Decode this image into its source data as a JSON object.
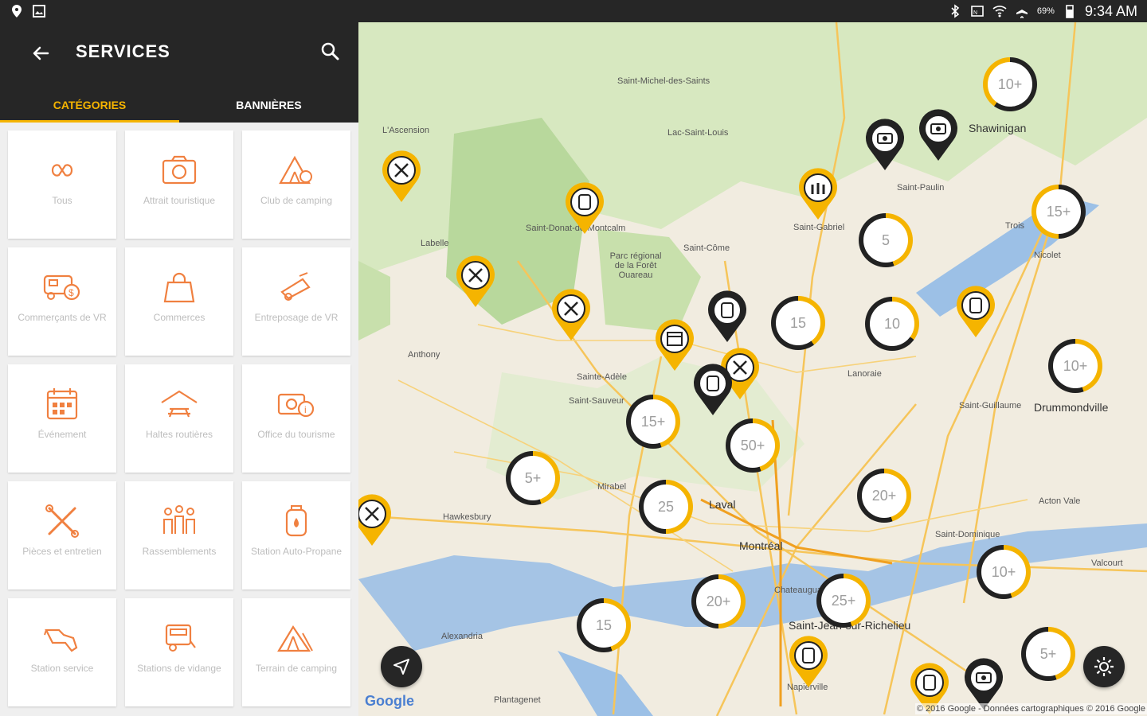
{
  "status": {
    "time": "9:34 AM",
    "battery": "69%"
  },
  "header": {
    "title": "SERVICES"
  },
  "tabs": [
    {
      "label": "CATÉGORIES",
      "active": true
    },
    {
      "label": "BANNIÈRES",
      "active": false
    }
  ],
  "categories": [
    {
      "label": "Tous",
      "icon": "infinity-icon"
    },
    {
      "label": "Attrait touristique",
      "icon": "camera-icon"
    },
    {
      "label": "Club de camping",
      "icon": "tent-club-icon"
    },
    {
      "label": "Commerçants de VR",
      "icon": "rv-dealer-icon"
    },
    {
      "label": "Commerces",
      "icon": "shopping-bag-icon"
    },
    {
      "label": "Entreposage de VR",
      "icon": "storage-icon"
    },
    {
      "label": "Événement",
      "icon": "calendar-icon"
    },
    {
      "label": "Haltes routières",
      "icon": "rest-area-icon"
    },
    {
      "label": "Office du tourisme",
      "icon": "tourism-office-icon"
    },
    {
      "label": "Pièces et entretien",
      "icon": "tools-icon"
    },
    {
      "label": "Rassemblements",
      "icon": "people-icon"
    },
    {
      "label": "Station Auto-Propane",
      "icon": "propane-icon"
    },
    {
      "label": "Station service",
      "icon": "fuel-pump-icon"
    },
    {
      "label": "Stations de vidange",
      "icon": "dump-station-icon"
    },
    {
      "label": "Terrain de camping",
      "icon": "campground-icon"
    }
  ],
  "map": {
    "clusters": [
      "10+",
      "15+",
      "5",
      "15",
      "10",
      "10+",
      "15+",
      "50+",
      "5+",
      "25",
      "20+",
      "10+",
      "20+",
      "25+",
      "15",
      "5+"
    ],
    "labels": [
      "L'Ascension",
      "Saint-Michel-des-Saints",
      "Lac-Saint-Louis",
      "Shawinigan",
      "Saint-Gabriel",
      "Saint-Côme",
      "Trois",
      "Nicolet",
      "Parc régional de la Forêt Ouareau",
      "Saint-Donat-de-Montcalm",
      "Drummondville",
      "Laval",
      "Montréal",
      "Saint-Jean-sur-Richelieu",
      "Hawkesbury",
      "Alexandria",
      "Napierville",
      "Saint-Guillaume",
      "Acton Vale",
      "Saint-Dominique",
      "Valcourt",
      "Mirabel",
      "Saint-Sauveur",
      "Sainte-Adèle",
      "Anthony",
      "Labelle",
      "Saint-Paulin",
      "Lanoraie",
      "Chateauguay",
      "Plantagenet"
    ],
    "google": "Google",
    "copyright": "© 2016 Google - Données cartographiques © 2016 Google"
  }
}
